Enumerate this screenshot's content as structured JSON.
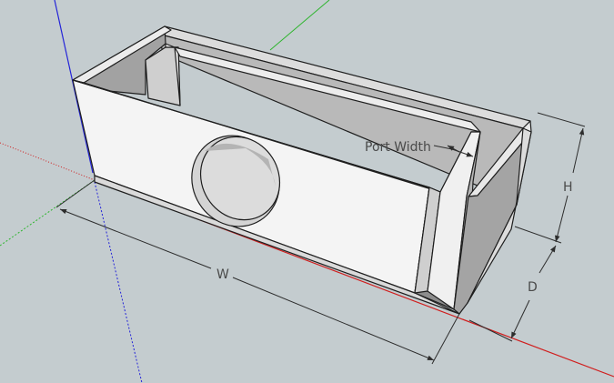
{
  "dimensions": {
    "width_label": "W",
    "height_label": "H",
    "depth_label": "D",
    "port_label": "Port Width"
  },
  "colors": {
    "background": "#c4cccf",
    "x_axis": "#d01e1e",
    "y_axis": "#2fb52f",
    "z_axis": "#2424d8",
    "face_light": "#f4f4f4",
    "face_mid": "#dcdcdc",
    "face_shadow": "#a8a8a8",
    "face_dark": "#8d8d8d"
  }
}
